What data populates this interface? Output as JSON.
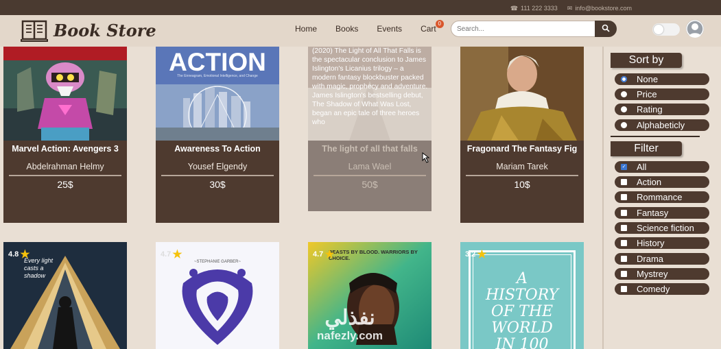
{
  "topbar": {
    "phone": "111 222 3333",
    "email": "info@bookstore.com"
  },
  "header": {
    "logo_text": "Book Store"
  },
  "nav": {
    "home": "Home",
    "books": "Books",
    "events": "Events",
    "cart": "Cart",
    "cart_count": "0"
  },
  "search": {
    "placeholder": "Search..."
  },
  "books": [
    {
      "title": "Marvel Action: Avengers 3",
      "author": "Abdelrahman Helmy",
      "price": "25$"
    },
    {
      "title": "Awareness To Action",
      "author": "Yousef Elgendy",
      "price": "30$",
      "cover_title": "ACTION",
      "cover_subtitle": "The Enneagram, Emotional Intelligence, and Change"
    },
    {
      "title": "The light of all that falls",
      "author": "Lama Wael",
      "price": "50$",
      "description": "(2020) The Light of All That Falls is the spectacular conclusion to James Islington's Licanius trilogy – a modern fantasy blockbuster packed with magic, prophecy and adventure. James Islington's bestselling debut, The Shadow of What Was Lost, began an epic tale of three heroes who"
    },
    {
      "title": "Fragonard The Fantasy Fig",
      "author": "Mariam Tarek",
      "price": "10$"
    }
  ],
  "row2": [
    {
      "rating": "4.8",
      "cover_text": "Every light casts a shadow"
    },
    {
      "rating": "4.7",
      "cover_text": "~STEPHANIE GARBER~"
    },
    {
      "rating": "4.7",
      "cover_text": "BEASTS BY BLOOD. WARRIORS BY CHOICE."
    },
    {
      "rating": "3.2",
      "cover_text": "A HISTORY OF THE WORLD IN 100"
    }
  ],
  "sort": {
    "heading": "Sort by",
    "options": [
      "None",
      "Price",
      "Rating",
      "Alphabeticly"
    ],
    "selected": "None"
  },
  "filter": {
    "heading": "Filter",
    "options": [
      "All",
      "Action",
      "Rommance",
      "Fantasy",
      "Science fiction",
      "History",
      "Drama",
      "Mystrey",
      "Comedy"
    ],
    "checked": "All"
  },
  "watermark": {
    "arabic": "نفذلي",
    "latin": "nafezly.com"
  },
  "colors": {
    "brown": "#4e3a2f",
    "background": "#e9dfd4",
    "accent": "#d9562b"
  }
}
